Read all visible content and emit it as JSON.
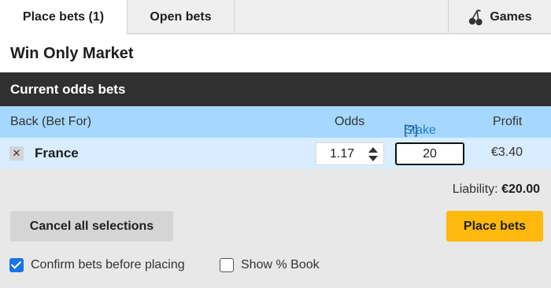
{
  "tabs": {
    "place_bets": "Place bets (1)",
    "open_bets": "Open bets",
    "games": "Games",
    "games_icon": "cherries-icon"
  },
  "market_title": "Win Only Market",
  "section_title": "Current odds bets",
  "columns": {
    "back": "Back (Bet For)",
    "odds": "Odds",
    "stake": "Stake",
    "stake_help": "[?]",
    "profit": "Profit"
  },
  "bet": {
    "runner": "France",
    "odds": "1.17",
    "stake": "20",
    "profit": "€3.40",
    "remove_icon": "close-icon"
  },
  "liability": {
    "label": "Liability:",
    "value": "€20.00"
  },
  "actions": {
    "cancel": "Cancel all selections",
    "place": "Place bets"
  },
  "options": {
    "confirm_label": "Confirm bets before placing",
    "confirm_checked": true,
    "book_label": "Show % Book",
    "book_checked": false
  },
  "colors": {
    "header_dark": "#303030",
    "column_header": "#a6d8ff",
    "bet_row": "#d8edff",
    "place_button": "#ffb80c",
    "stake_link": "#1b7fd1"
  }
}
